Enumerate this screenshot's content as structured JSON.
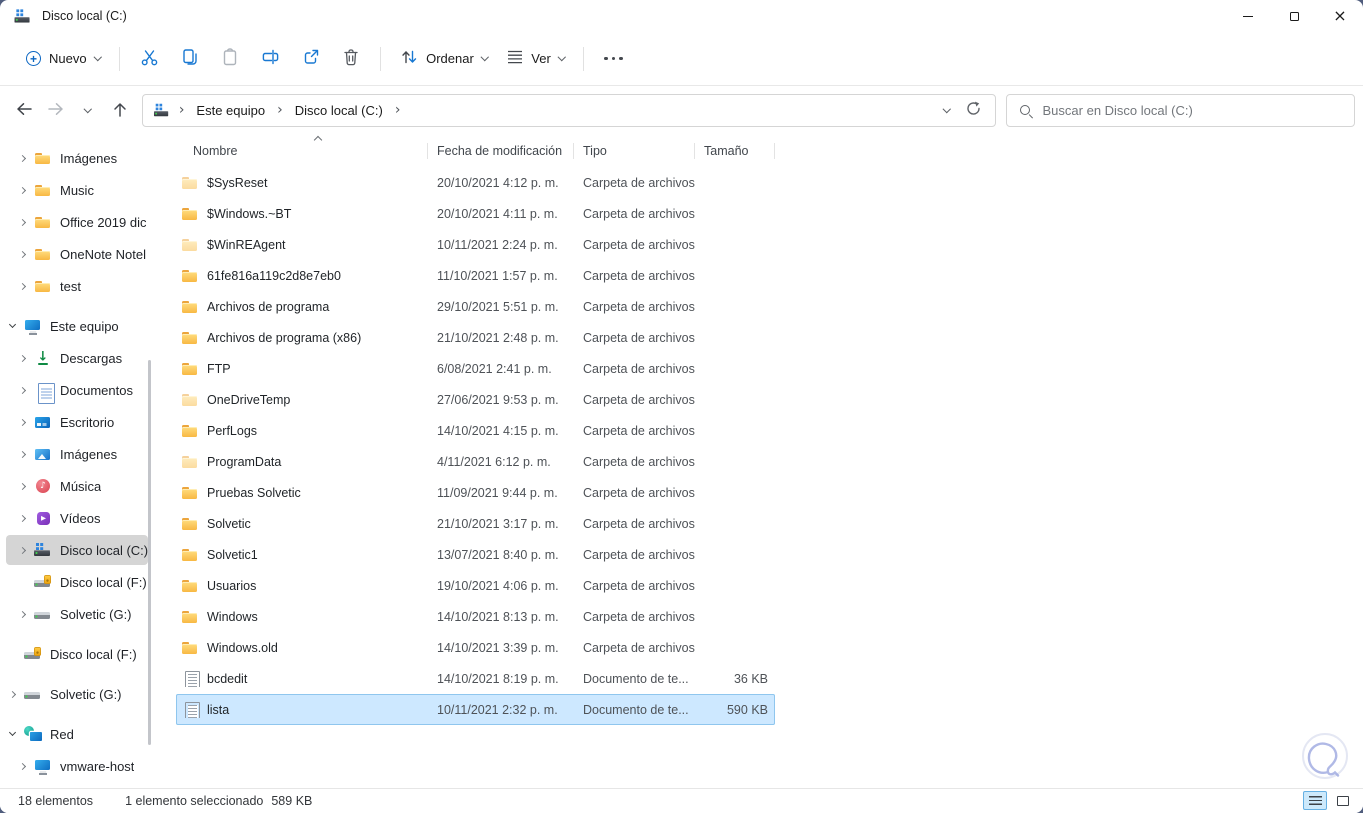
{
  "window": {
    "title": "Disco local (C:)"
  },
  "toolbar": {
    "new": "Nuevo",
    "sort": "Ordenar",
    "view": "Ver"
  },
  "navbar": {
    "breadcrumbs": [
      "Este equipo",
      "Disco local (C:)"
    ]
  },
  "search": {
    "placeholder": "Buscar en Disco local (C:)"
  },
  "sidebar": {
    "items": [
      {
        "label": "Imágenes",
        "icon": "folder",
        "chevron": "right",
        "indent": 1
      },
      {
        "label": "Music",
        "icon": "folder",
        "chevron": "right",
        "indent": 1
      },
      {
        "label": "Office 2019 dic",
        "icon": "folder",
        "chevron": "right",
        "indent": 1
      },
      {
        "label": "OneNote Notel",
        "icon": "folder",
        "chevron": "right",
        "indent": 1
      },
      {
        "label": "test",
        "icon": "folder",
        "chevron": "right",
        "indent": 1
      },
      {
        "label": "Este equipo",
        "icon": "monitor",
        "chevron": "down",
        "indent": 0,
        "gap": true
      },
      {
        "label": "Descargas",
        "icon": "download",
        "chevron": "right",
        "indent": 1
      },
      {
        "label": "Documentos",
        "icon": "document",
        "chevron": "right",
        "indent": 1
      },
      {
        "label": "Escritorio",
        "icon": "desktop",
        "chevron": "right",
        "indent": 1
      },
      {
        "label": "Imágenes",
        "icon": "pictures",
        "chevron": "right",
        "indent": 1
      },
      {
        "label": "Música",
        "icon": "music",
        "chevron": "right",
        "indent": 1
      },
      {
        "label": "Vídeos",
        "icon": "videos",
        "chevron": "right",
        "indent": 1
      },
      {
        "label": "Disco local (C:)",
        "icon": "drive-win",
        "chevron": "right",
        "indent": 1,
        "selected": true
      },
      {
        "label": "Disco local (F:)",
        "icon": "drive-lock",
        "chevron": "none",
        "indent": 1
      },
      {
        "label": "Solvetic (G:)",
        "icon": "drive",
        "chevron": "right",
        "indent": 1
      },
      {
        "label": "Disco local (F:)",
        "icon": "drive-lock",
        "chevron": "none",
        "indent": 0,
        "gap": true
      },
      {
        "label": "Solvetic (G:)",
        "icon": "drive",
        "chevron": "right",
        "indent": 0,
        "gap": true
      },
      {
        "label": "Red",
        "icon": "network",
        "chevron": "down",
        "indent": 0,
        "gap": true
      },
      {
        "label": "vmware-host",
        "icon": "monitor",
        "chevron": "right",
        "indent": 1
      }
    ]
  },
  "filelist": {
    "columns": [
      "Nombre",
      "Fecha de modificación",
      "Tipo",
      "Tamaño"
    ],
    "rows": [
      {
        "name": "$SysReset",
        "date": "20/10/2021 4:12 p. m.",
        "type": "Carpeta de archivos",
        "size": "",
        "icon": "folder-hidden"
      },
      {
        "name": "$Windows.~BT",
        "date": "20/10/2021 4:11 p. m.",
        "type": "Carpeta de archivos",
        "size": "",
        "icon": "folder"
      },
      {
        "name": "$WinREAgent",
        "date": "10/11/2021 2:24 p. m.",
        "type": "Carpeta de archivos",
        "size": "",
        "icon": "folder-hidden"
      },
      {
        "name": "61fe816a119c2d8e7eb0",
        "date": "11/10/2021 1:57 p. m.",
        "type": "Carpeta de archivos",
        "size": "",
        "icon": "folder"
      },
      {
        "name": "Archivos de programa",
        "date": "29/10/2021 5:51 p. m.",
        "type": "Carpeta de archivos",
        "size": "",
        "icon": "folder"
      },
      {
        "name": "Archivos de programa (x86)",
        "date": "21/10/2021 2:48 p. m.",
        "type": "Carpeta de archivos",
        "size": "",
        "icon": "folder"
      },
      {
        "name": "FTP",
        "date": "6/08/2021 2:41 p. m.",
        "type": "Carpeta de archivos",
        "size": "",
        "icon": "folder"
      },
      {
        "name": "OneDriveTemp",
        "date": "27/06/2021 9:53 p. m.",
        "type": "Carpeta de archivos",
        "size": "",
        "icon": "folder-hidden"
      },
      {
        "name": "PerfLogs",
        "date": "14/10/2021 4:15 p. m.",
        "type": "Carpeta de archivos",
        "size": "",
        "icon": "folder"
      },
      {
        "name": "ProgramData",
        "date": "4/11/2021 6:12 p. m.",
        "type": "Carpeta de archivos",
        "size": "",
        "icon": "folder-hidden"
      },
      {
        "name": "Pruebas Solvetic",
        "date": "11/09/2021 9:44 p. m.",
        "type": "Carpeta de archivos",
        "size": "",
        "icon": "folder"
      },
      {
        "name": "Solvetic",
        "date": "21/10/2021 3:17 p. m.",
        "type": "Carpeta de archivos",
        "size": "",
        "icon": "folder"
      },
      {
        "name": "Solvetic1",
        "date": "13/07/2021 8:40 p. m.",
        "type": "Carpeta de archivos",
        "size": "",
        "icon": "folder"
      },
      {
        "name": "Usuarios",
        "date": "19/10/2021 4:06 p. m.",
        "type": "Carpeta de archivos",
        "size": "",
        "icon": "folder"
      },
      {
        "name": "Windows",
        "date": "14/10/2021 8:13 p. m.",
        "type": "Carpeta de archivos",
        "size": "",
        "icon": "folder"
      },
      {
        "name": "Windows.old",
        "date": "14/10/2021 3:39 p. m.",
        "type": "Carpeta de archivos",
        "size": "",
        "icon": "folder"
      },
      {
        "name": "bcdedit",
        "date": "14/10/2021 8:19 p. m.",
        "type": "Documento de te...",
        "size": "36 KB",
        "icon": "text-file"
      },
      {
        "name": "lista",
        "date": "10/11/2021 2:32 p. m.",
        "type": "Documento de te...",
        "size": "590 KB",
        "icon": "text-file",
        "selected": true
      }
    ]
  },
  "statusbar": {
    "count": "18 elementos",
    "selection": "1 elemento seleccionado",
    "size": "589 KB"
  },
  "colors": {
    "accent": "#0b66c2",
    "selection_bg": "#cde8ff",
    "selection_border": "#8fc6ee",
    "folder": "#f8b843"
  }
}
